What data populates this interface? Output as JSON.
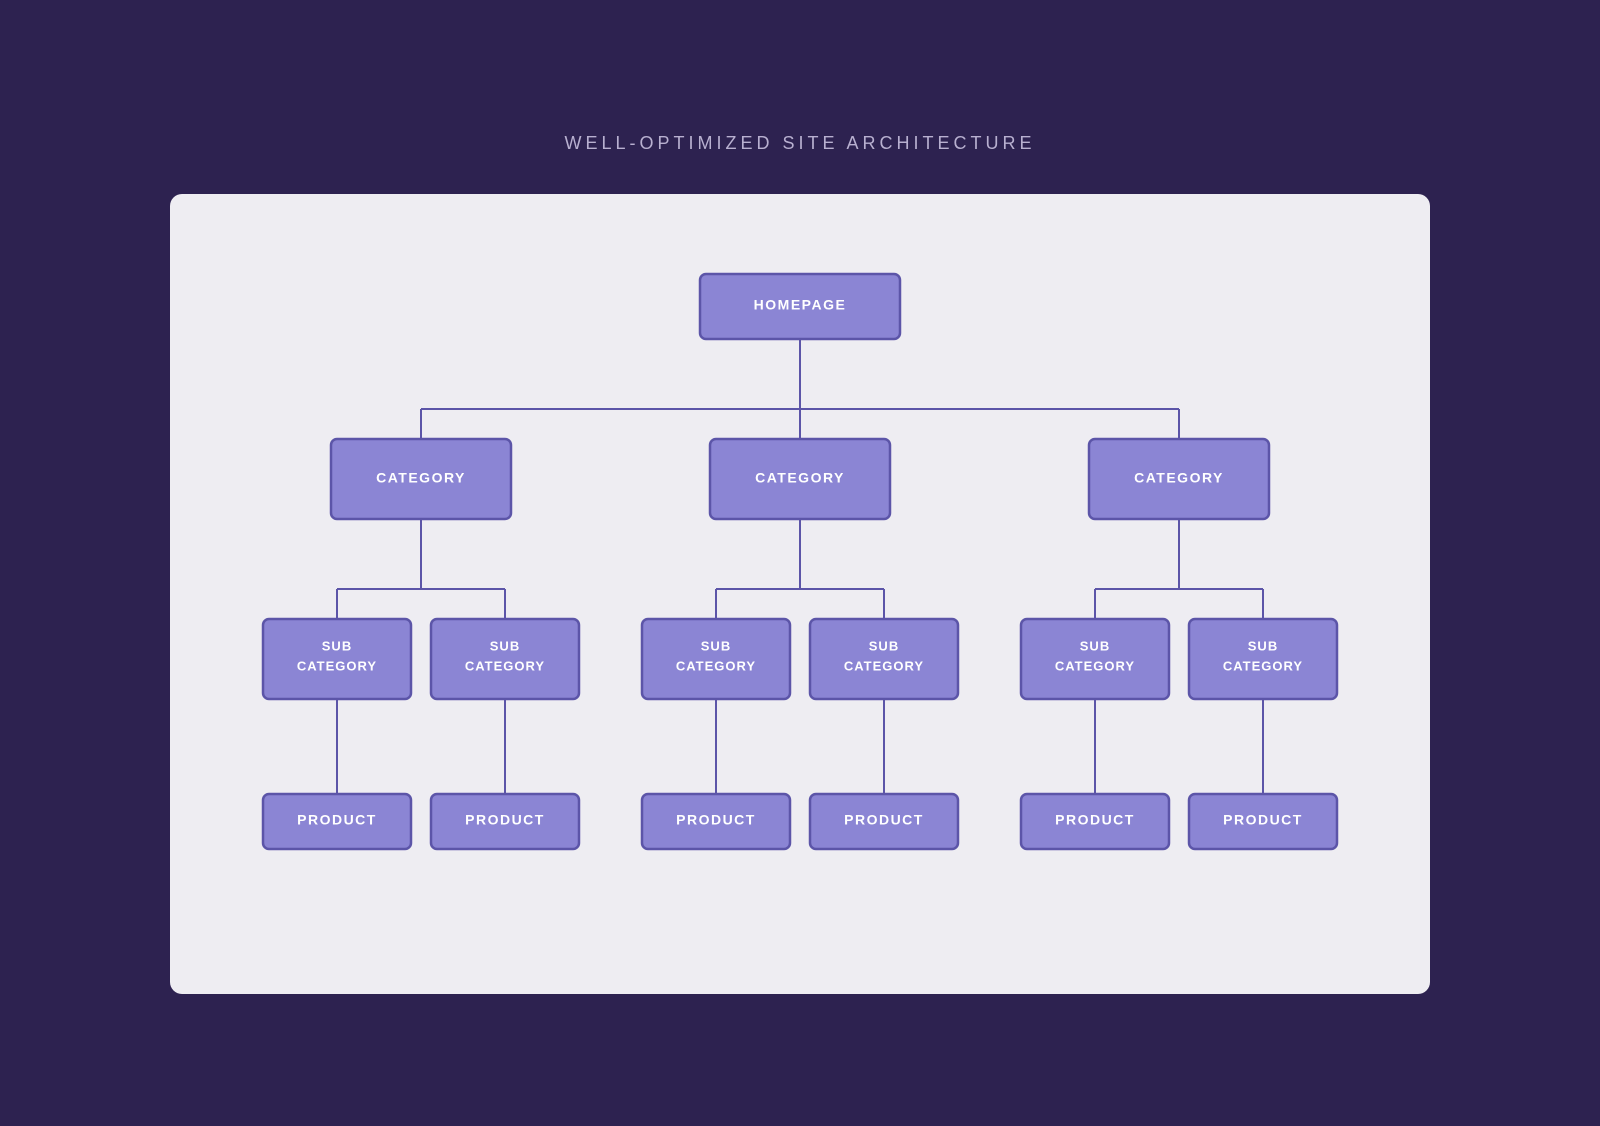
{
  "title": "WELL-OPTIMIZED SITE ARCHITECTURE",
  "colors": {
    "bg": "#2d2250",
    "diagram_bg": "#eeedf2",
    "node_fill": "#8b85d4",
    "node_border": "#5c55a8",
    "connector": "#5c55a8"
  },
  "nodes": {
    "homepage": "HOMEPAGE",
    "categories": [
      "CATEGORY",
      "CATEGORY",
      "CATEGORY"
    ],
    "subcategories": [
      "SUB CATEGORY",
      "SUB CATEGORY",
      "SUB CATEGORY",
      "SUB CATEGORY",
      "SUB CATEGORY",
      "SUB CATEGORY"
    ],
    "products": [
      "PRODUCT",
      "PRODUCT",
      "PRODUCT",
      "PRODUCT",
      "PRODUCT",
      "PRODUCT"
    ]
  }
}
